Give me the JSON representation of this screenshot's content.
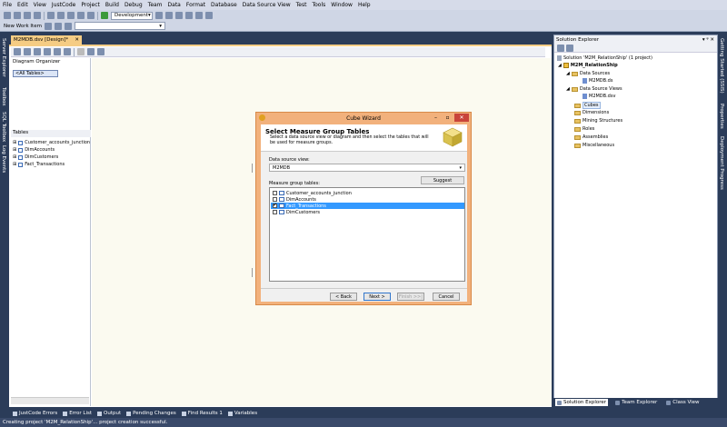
{
  "menu": [
    "File",
    "Edit",
    "View",
    "JustCode",
    "Project",
    "Build",
    "Debug",
    "Team",
    "Data",
    "Format",
    "Database",
    "Data Source View",
    "Test",
    "Tools",
    "Window",
    "Help"
  ],
  "toolbar": {
    "config": "Development",
    "new_work_item": "New Work Item"
  },
  "left_vtabs": [
    "Server Explorer",
    "Toolbox",
    "SQL Toolbox",
    "Log Events"
  ],
  "right_vtabs": [
    "Getting Started (SSIS)",
    "Properties",
    "Deployment Progress"
  ],
  "document": {
    "tab": "M2MDB.dsv [Design]*",
    "diagram_organizer": "Diagram Organizer",
    "all_tables": "<All Tables>",
    "tables_header": "Tables",
    "tables": [
      "Customer_accounts_junction",
      "DimAccounts",
      "DimCustomers",
      "Fact_Transactions"
    ]
  },
  "dialog": {
    "title": "Cube Wizard",
    "header_title": "Select Measure Group Tables",
    "header_subtitle": "Select a data source view or diagram and then select the tables that will be used for measure groups.",
    "dsv_label": "Data source view:",
    "dsv_value": "M2MDB",
    "measure_label": "Measure group tables:",
    "suggest": "Suggest",
    "items": [
      {
        "label": "Customer_accounts_junction",
        "checked": false,
        "selected": false
      },
      {
        "label": "DimAccounts",
        "checked": false,
        "selected": false
      },
      {
        "label": "Fact_Transactions",
        "checked": true,
        "selected": true
      },
      {
        "label": "DimCustomers",
        "checked": false,
        "selected": false
      }
    ],
    "back": "< Back",
    "next": "Next >",
    "finish": "Finish >>|",
    "cancel": "Cancel",
    "check_mark": "✔"
  },
  "solution_explorer": {
    "title": "Solution Explorer",
    "pin": "▾ ᵠ ✕",
    "solution": "Solution 'M2M_RelationShip' (1 project)",
    "project": "M2M_RelationShip",
    "data_sources": "Data Sources",
    "ds_file": "M2MDB.ds",
    "data_source_views": "Data Source Views",
    "dsv_file": "M2MDB.dsv",
    "cubes": "Cubes",
    "dimensions": "Dimensions",
    "mining": "Mining Structures",
    "roles": "Roles",
    "assemblies": "Assemblies",
    "misc": "Miscellaneous",
    "tabs": [
      "Solution Explorer",
      "Team Explorer",
      "Class View"
    ]
  },
  "bottom_tabs": [
    "JustCode Errors",
    "Error List",
    "Output",
    "Pending Changes",
    "Find Results 1",
    "Variables"
  ],
  "status": "Creating project 'M2M_RelationShip'... project creation successful."
}
